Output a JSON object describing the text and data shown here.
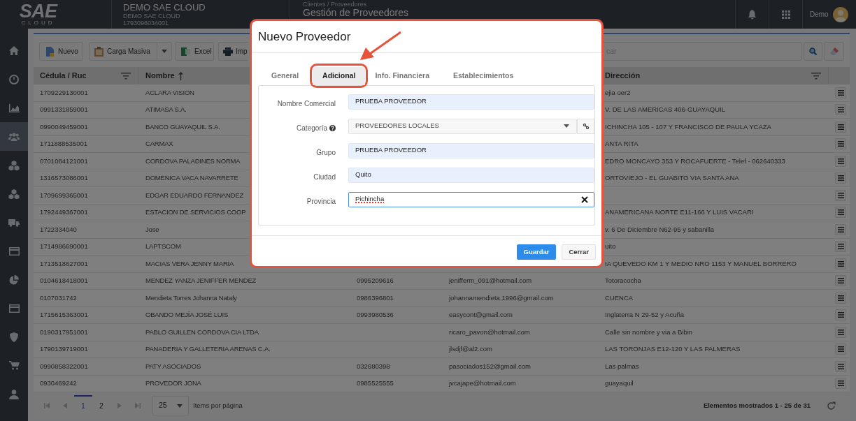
{
  "header": {
    "logo": "SAE",
    "logo_sub": "CLOUD",
    "company": "DEMO SAE CLOUD",
    "company_sub": "DEMO SAE CLOUD",
    "ruc": "1793096034001",
    "breadcrumb": "Clientes / Proveedores",
    "page_title": "Gestión de Proveedores",
    "user": "Demo"
  },
  "sidebar": {
    "items": [
      {
        "kind": "home",
        "selected": false
      },
      {
        "kind": "gauge",
        "selected": false
      },
      {
        "kind": "chart",
        "selected": false
      },
      {
        "kind": "users",
        "selected": true
      },
      {
        "kind": "cubes",
        "selected": false
      },
      {
        "kind": "cubes",
        "selected": false
      },
      {
        "kind": "truck",
        "selected": false
      },
      {
        "kind": "card",
        "selected": false
      },
      {
        "kind": "pie",
        "selected": false
      },
      {
        "kind": "card",
        "selected": false
      },
      {
        "kind": "shield",
        "selected": false
      },
      {
        "kind": "cart",
        "selected": false
      },
      {
        "kind": "user",
        "selected": false
      }
    ]
  },
  "toolbar": {
    "buttons": [
      {
        "kind": "new",
        "label": "Nuevo"
      },
      {
        "kind": "upload",
        "label": "Carga Masiva"
      },
      {
        "kind": "caret"
      },
      {
        "kind": "excel",
        "label": "Excel"
      },
      {
        "kind": "print",
        "label": "Imp"
      }
    ],
    "search": {
      "placeholder": "car"
    }
  },
  "table": {
    "columns": [
      {
        "label": "Cédula / Ruc",
        "filter": true,
        "sorted": false
      },
      {
        "label": "Nombre",
        "filter": false,
        "sorted": true
      },
      {
        "label": "Dirección",
        "filter": true,
        "sorted": false
      }
    ],
    "rows": [
      {
        "cedula": "1709229130001",
        "nombre": "ACLARA VISION",
        "direccion": "ejia oer2"
      },
      {
        "cedula": "0991331859001",
        "nombre": "ATIMASA S.A.",
        "direccion": "V. DE LAS AMERICAS 406-GUAYAQUIL"
      },
      {
        "cedula": "0990049459001",
        "nombre": "BANCO GUAYAQUIL S.A.",
        "direccion": "ICHINCHA 105 - 107 Y FRANCISCO DE PAULA YCAZA"
      },
      {
        "cedula": "1711888535001",
        "nombre": "CARMAX",
        "direccion": "ANTA RITA"
      },
      {
        "cedula": "0701084121001",
        "nombre": "CORDOVA PALADINES NORMA",
        "direccion": "EDRO MONCAYO 353 Y ROCAFUERTE - Telef - 062640333"
      },
      {
        "cedula": "1316573086001",
        "nombre": "DOMENICA VACA NAVARRETE",
        "direccion": "ORTOVIEJO - EL GUABITO VIA SANTA ANA"
      },
      {
        "cedula": "1709699365001",
        "nombre": "EDGAR EDUARDO FERNANDEZ"
      },
      {
        "cedula": "1792449367001",
        "nombre": "ESTACION DE SERVICIOS COOP",
        "direccion": "ANAMERICANA NORTE E11-166 Y LUIS VACARI"
      },
      {
        "cedula": "1722334040",
        "nombre": "Jose",
        "direccion": "v. 6 De Diciembre N62-95 y sabanilla"
      },
      {
        "cedula": "1714986690001",
        "nombre": "LAPTSCOM",
        "direccion": "uito"
      },
      {
        "cedula": "1713518627001",
        "nombre": "MACIAS VERA JENNY MARIA",
        "direccion": "IA QUEVEDO KM 1 Y MEDIO NRO 1153 Y MANUEL BORRERO"
      },
      {
        "cedula": "0104618418001",
        "nombre": "MENDEZ YANZA JENIFFER MENDEZ",
        "column_3": "0995209616",
        "column_4": "jenifferm_091@hotmail.com",
        "direccion": "Totoracocha"
      },
      {
        "cedula": "0107031742",
        "nombre": "Mendieta Torres Johanna Nataly",
        "column_3": "0986396801",
        "column_4": "johannamendieta.1996@gmail.com",
        "direccion": "CUENCA"
      },
      {
        "cedula": "1715615363001",
        "nombre": "OBANDO MEJÍA JOSÉ LUIS",
        "column_3": "0993980536",
        "column_4": "easycont@gmail.com",
        "direccion": "Inglaterra N 29-52 y Acuña"
      },
      {
        "cedula": "0190317951001",
        "nombre": "PABLO GUILLEN CORDOVA CIA LTDA",
        "column_4": "ricaro_pavon@hotmail.com",
        "direccion": "Calle sin nombre y via a Bibin"
      },
      {
        "cedula": "1790139719001",
        "nombre": "PANADERIA Y GALLETERIA ARENAS C.A.",
        "column_4": "jlsdjf@al2.com",
        "direccion": "LAS TORONJAS E12-120 Y LAS PALMERAS"
      },
      {
        "cedula": "0990858322001",
        "nombre": "PATY ASOCIADOS",
        "column_3": "032680398",
        "column_4": "pasociados152@gmail.com",
        "direccion": "Las palmas"
      },
      {
        "cedula": "0930469242",
        "nombre": "PROVEDOR JONA",
        "column_3": "0985525555",
        "column_4": "jvcajape@hotmail.com",
        "direccion": "guayaquil"
      }
    ]
  },
  "pagination": {
    "pages": [
      {
        "label": "1",
        "selected": true
      },
      {
        "label": "2",
        "selected": false
      }
    ],
    "page_size": "25",
    "page_size_label": "ítems por página",
    "summary": "Elementos mostrados 1 - 25 de 31"
  },
  "modal": {
    "title": "Nuevo Proveedor",
    "highlighted": true,
    "callout_arrow": true,
    "tabs": [
      {
        "label": "General",
        "selected": false,
        "highlighted": false
      },
      {
        "label": "Adicional",
        "selected": true,
        "highlighted": true
      },
      {
        "label": "Info. Financiera",
        "selected": false,
        "highlighted": false
      },
      {
        "label": "Establecimientos",
        "selected": false,
        "highlighted": false
      }
    ],
    "fields": [
      {
        "label": "Nombre Comercial",
        "value": "PRUEBA PROVEEDOR",
        "kind": "text",
        "help": false,
        "autofilled": true,
        "focused": false,
        "misspelled": false
      },
      {
        "label": "Categoría",
        "value": "PROVEEDORES LOCALES",
        "kind": "select",
        "help": true,
        "autofilled": false,
        "focused": false,
        "misspelled": false
      },
      {
        "label": "Grupo",
        "value": "PRUEBA PROVEEDOR",
        "kind": "text",
        "help": false,
        "autofilled": true,
        "focused": false,
        "misspelled": false
      },
      {
        "label": "Ciudad",
        "value": "Quito",
        "kind": "text",
        "help": false,
        "autofilled": true,
        "focused": false,
        "misspelled": false
      },
      {
        "label": "Provincia",
        "value": "Pichincha",
        "kind": "search",
        "help": false,
        "autofilled": false,
        "focused": true,
        "misspelled": true
      }
    ],
    "buttons": [
      {
        "label": "Guardar",
        "kind": "primary"
      },
      {
        "label": "Cerrar",
        "kind": "secondary"
      }
    ]
  }
}
